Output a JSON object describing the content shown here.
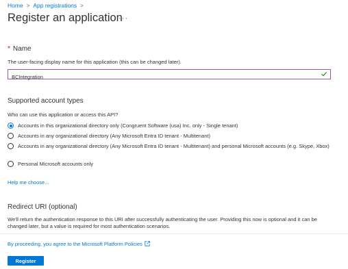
{
  "breadcrumb": {
    "items": [
      "Home",
      "App registrations"
    ]
  },
  "page": {
    "title": "Register an application",
    "more": "···"
  },
  "name_section": {
    "required_mark": "*",
    "heading": "Name",
    "description": "The user-facing display name for this application (this can be changed later).",
    "value": "BCIntegration"
  },
  "account_types": {
    "heading": "Supported account types",
    "question": "Who can use this application or access this API?",
    "options": [
      {
        "label": "Accounts in this organizational directory only (Congruent Software (usa) Inc. only - Single tenant)",
        "selected": true
      },
      {
        "label": "Accounts in any organizational directory (Any Microsoft Entra ID tenant - Multitenant)",
        "selected": false
      },
      {
        "label": "Accounts in any organizational directory (Any Microsoft Entra ID tenant - Multitenant) and personal Microsoft accounts (e.g. Skype, Xbox)",
        "selected": false
      },
      {
        "label": "Personal Microsoft accounts only",
        "selected": false
      }
    ],
    "help_link": "Help me choose..."
  },
  "redirect": {
    "heading": "Redirect URI (optional)",
    "description": "We'll return the authentication response to this URI after successfully authenticating the user. Providing this now is optional and it can be changed later, but a value is required for most authentication scenarios."
  },
  "footer": {
    "policy_link": "By proceeding, you agree to the Microsoft Platform Policies",
    "register_label": "Register"
  },
  "colors": {
    "accent": "#0078d4",
    "required": "#a4262c",
    "input_border": "#a055a6",
    "success": "#107c10"
  }
}
